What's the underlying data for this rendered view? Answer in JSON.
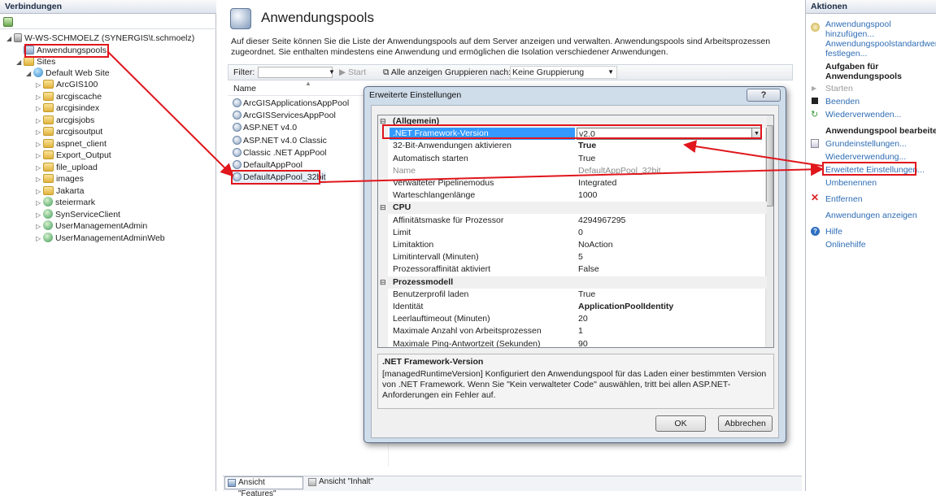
{
  "connections": {
    "title": "Verbindungen",
    "tree": [
      {
        "label": "W-WS-SCHMOELZ (SYNERGIS\\t.schmoelz)",
        "icon": "server-icon"
      },
      {
        "label": "Anwendungspools",
        "icon": "app-pool-icon"
      },
      {
        "label": "Sites",
        "icon": "folder-icon"
      },
      {
        "label": "Default Web Site",
        "icon": "globe-icon"
      },
      {
        "label": "ArcGIS100",
        "icon": "folder-icon"
      },
      {
        "label": "arcgiscache",
        "icon": "folder-icon"
      },
      {
        "label": "arcgisindex",
        "icon": "folder-icon"
      },
      {
        "label": "arcgisjobs",
        "icon": "folder-icon"
      },
      {
        "label": "arcgisoutput",
        "icon": "folder-icon"
      },
      {
        "label": "aspnet_client",
        "icon": "folder-icon"
      },
      {
        "label": "Export_Output",
        "icon": "folder-icon"
      },
      {
        "label": "file_upload",
        "icon": "folder-icon"
      },
      {
        "label": "images",
        "icon": "folder-icon"
      },
      {
        "label": "Jakarta",
        "icon": "folder-icon"
      },
      {
        "label": "steiermark",
        "icon": "application-icon"
      },
      {
        "label": "SynServiceClient",
        "icon": "application-icon"
      },
      {
        "label": "UserManagementAdmin",
        "icon": "application-icon"
      },
      {
        "label": "UserManagementAdminWeb",
        "icon": "application-icon"
      }
    ]
  },
  "main": {
    "title": "Anwendungspools",
    "description": "Auf dieser Seite können Sie die Liste der Anwendungspools auf dem Server anzeigen und verwalten. Anwendungspools sind Arbeitsprozessen zugeordnet. Sie enthalten mindestens eine Anwendung und ermöglichen die Isolation verschiedener Anwendungen.",
    "toolbar": {
      "filter_label": "Filter:",
      "start": "Start",
      "show_all": "Alle anzeigen",
      "group_label": "Gruppieren nach:",
      "group_value": "Keine Gruppierung"
    },
    "column_name": "Name",
    "pools": [
      "ArcGISApplicationsAppPool",
      "ArcGISServicesAppPool",
      "ASP.NET v4.0",
      "ASP.NET v4.0 Classic",
      "Classic .NET AppPool",
      "DefaultAppPool",
      "DefaultAppPool_32bit"
    ],
    "bottom_tabs": [
      "Ansicht \"Features\"",
      "Ansicht \"Inhalt\""
    ]
  },
  "actions": {
    "title": "Aktionen",
    "add_pool": "Anwendungspool hinzufügen...",
    "set_defaults": "Anwendungspoolstandardwerte festlegen...",
    "tasks_heading": "Aufgaben für Anwendungspools",
    "start": "Starten",
    "stop": "Beenden",
    "recycle": "Wiederverwenden...",
    "edit_heading": "Anwendungspool bearbeiten",
    "basic_settings": "Grundeinstellungen...",
    "recycling": "Wiederverwendung...",
    "advanced_settings": "Erweiterte Einstellungen...",
    "rename": "Umbenennen",
    "remove": "Entfernen",
    "view_apps": "Anwendungen anzeigen",
    "help": "Hilfe",
    "online_help": "Onlinehilfe"
  },
  "dialog": {
    "title": "Erweiterte Einstellungen",
    "close": "?",
    "rows": [
      {
        "type": "cat",
        "name": "(Allgemein)"
      },
      {
        "name": ".NET Framework-Version",
        "value": "v2.0",
        "selected": true
      },
      {
        "name": "32-Bit-Anwendungen aktivieren",
        "value": "True",
        "bold": true
      },
      {
        "name": "Automatisch starten",
        "value": "True"
      },
      {
        "name": "Name",
        "value": "DefaultAppPool_32bit",
        "dim": true
      },
      {
        "name": "Verwalteter Pipelinemodus",
        "value": "Integrated"
      },
      {
        "name": "Warteschlangenlänge",
        "value": "1000"
      },
      {
        "type": "cat",
        "name": "CPU"
      },
      {
        "name": "Affinitätsmaske für Prozessor",
        "value": "4294967295"
      },
      {
        "name": "Limit",
        "value": "0"
      },
      {
        "name": "Limitaktion",
        "value": "NoAction"
      },
      {
        "name": "Limitintervall (Minuten)",
        "value": "5"
      },
      {
        "name": "Prozessoraffinität aktiviert",
        "value": "False"
      },
      {
        "type": "cat",
        "name": "Prozessmodell"
      },
      {
        "name": "Benutzerprofil laden",
        "value": "True"
      },
      {
        "name": "Identität",
        "value": "ApplicationPoolIdentity",
        "bold": true
      },
      {
        "name": "Leerlauftimeout (Minuten)",
        "value": "20"
      },
      {
        "name": "Maximale Anzahl von Arbeitsprozessen",
        "value": "1"
      },
      {
        "name": "Maximale Ping-Antwortzeit (Sekunden)",
        "value": "90"
      }
    ],
    "desc_title": ".NET Framework-Version",
    "desc_text": "[managedRuntimeVersion] Konfiguriert den Anwendungspool für das Laden einer bestimmten Version von .NET Framework. Wenn Sie \"Kein verwalteter Code\" auswählen, tritt bei allen ASP.NET-Anforderungen ein Fehler auf.",
    "ok": "OK",
    "cancel": "Abbrechen"
  },
  "colors": {
    "highlight": "#e0161c",
    "link": "#2f6db5",
    "selection": "#3399ff"
  }
}
